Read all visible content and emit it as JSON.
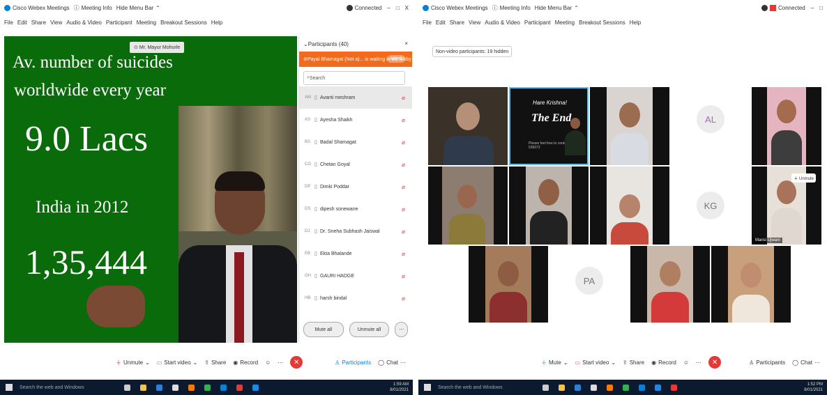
{
  "left": {
    "titlebar": {
      "app": "Cisco Webex Meetings",
      "info": "Meeting Info",
      "hide": "Hide Menu Bar",
      "status": "Connected",
      "min": "–",
      "max": "□",
      "close": "X"
    },
    "menu": [
      "File",
      "Edit",
      "Share",
      "View",
      "Audio & Video",
      "Participant",
      "Meeting",
      "Breakout Sessions",
      "Help"
    ],
    "slide": {
      "line1": "Av. number of suicides",
      "line2": "worldwide every year",
      "big1": "9.0 Lacs",
      "line3": "India in 2012",
      "big2": "1,35,444"
    },
    "nametag": "Mr. Mayur Mohurle",
    "panel": {
      "title": "Participants (40)",
      "lobby": "Payal Bhamagat (Not a)... is waiting in the lobby",
      "admit": "Admit",
      "search": "Search",
      "participants": [
        {
          "ini": "AM",
          "name": "Avanti meshram"
        },
        {
          "ini": "AS",
          "name": "Ayesha Shaikh"
        },
        {
          "ini": "BS",
          "name": "Badal Shamagat"
        },
        {
          "ini": "CG",
          "name": "Chetan Goyal"
        },
        {
          "ini": "DP",
          "name": "Dimki Poddar"
        },
        {
          "ini": "DS",
          "name": "dipesh sonewane"
        },
        {
          "ini": "DJ",
          "name": "Dr. Sneha Subhash Jaiswal"
        },
        {
          "ini": "EB",
          "name": "Ekta Bhalande"
        },
        {
          "ini": "GH",
          "name": "GAURI HADGE"
        },
        {
          "ini": "HB",
          "name": "harsh bindal"
        }
      ],
      "mute_all": "Mute all",
      "unmute_all": "Unmute all"
    },
    "toolbar": {
      "unmute": "Unmute",
      "start_video": "Start video",
      "share": "Share",
      "record": "Record",
      "participants": "Participants",
      "chat": "Chat"
    },
    "taskbar": {
      "search": "Search the web and Windows",
      "time": "1:59 AM",
      "date": "8/01/2021"
    }
  },
  "right": {
    "titlebar": {
      "app": "Cisco Webex Meetings",
      "info": "Meeting Info",
      "hide": "Hide Menu Bar",
      "status": "Connected",
      "min": "–",
      "max": "□"
    },
    "menu": [
      "File",
      "Edit",
      "Share",
      "View",
      "Audio & Video",
      "Participant",
      "Meeting",
      "Breakout Sessions",
      "Help"
    ],
    "chip": "Non-video participants: 19 hidden",
    "tiles": {
      "al": "AL",
      "kg": "KG",
      "pa": "PA",
      "unmute": "Unmute",
      "name_tag": "Mansi Ujwani"
    },
    "end_slide": {
      "line1": "Hare Krishna!",
      "line2": "The End",
      "line3": "Please feel free to contact 3300 - 536072"
    },
    "toolbar": {
      "mute": "Mute",
      "start_video": "Start video",
      "share": "Share",
      "record": "Record",
      "participants": "Participants",
      "chat": "Chat"
    },
    "taskbar": {
      "search": "Search the web and Windows",
      "time": "1:52 PM",
      "date": "8/01/2021"
    }
  }
}
